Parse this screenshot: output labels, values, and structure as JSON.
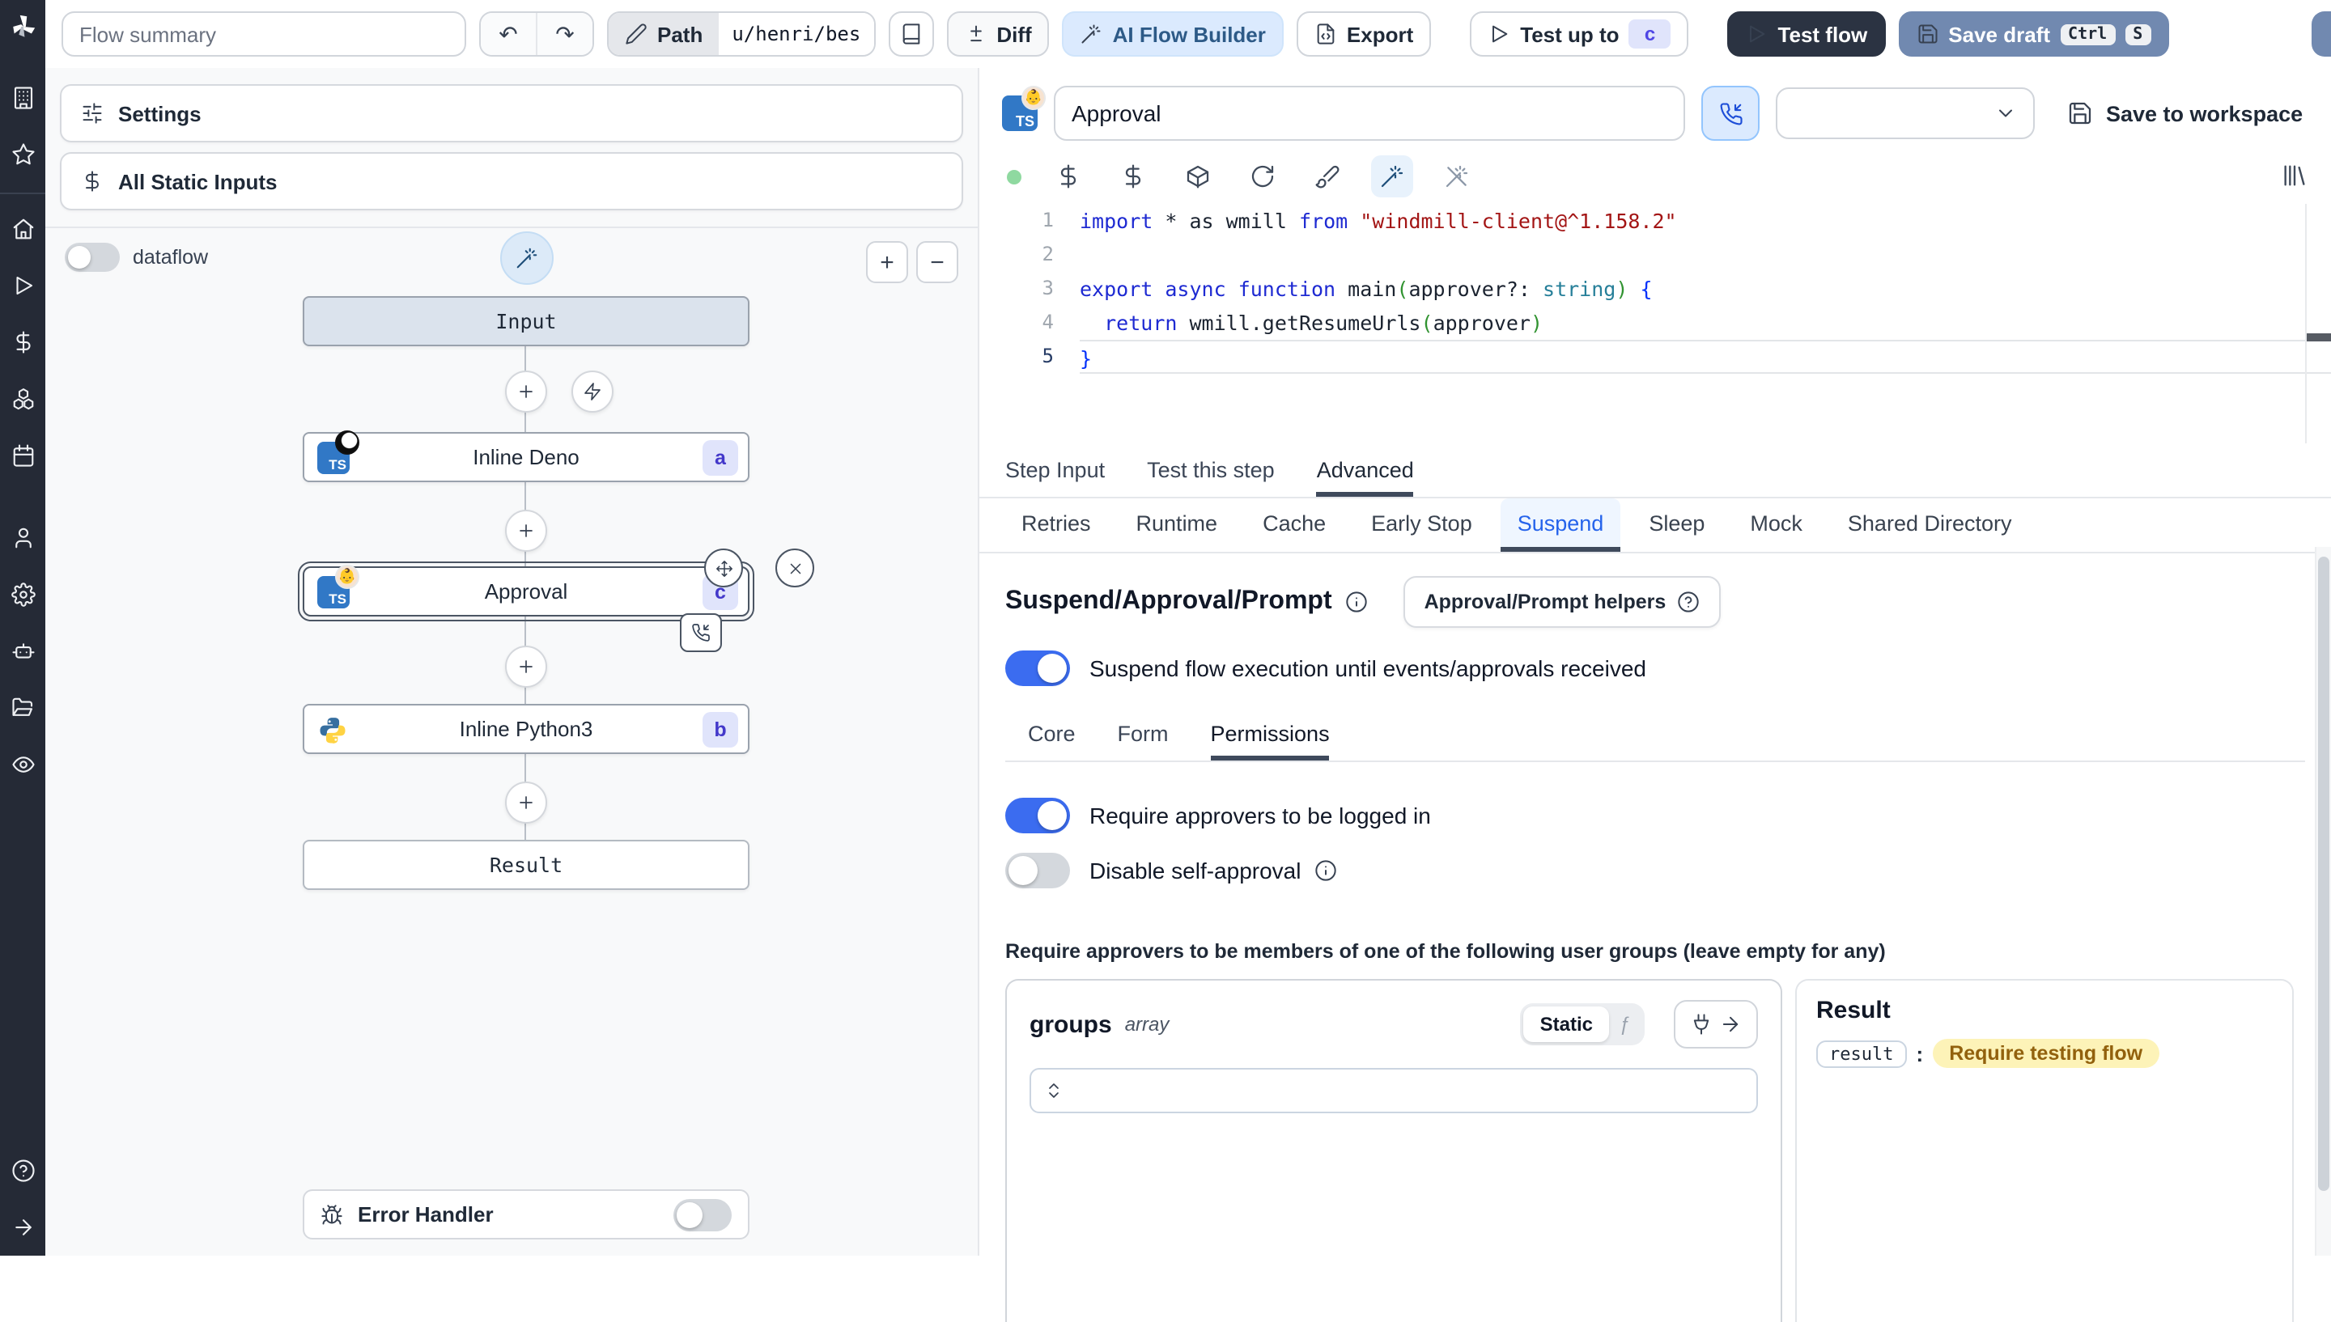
{
  "icons": {
    "undo": "↶",
    "redo": "↷",
    "zoom_in": "+",
    "zoom_out": "−",
    "fn": "ƒ",
    "baby": "👶"
  },
  "topbar": {
    "summary_placeholder": "Flow summary",
    "path_label": "Path",
    "path_value": "u/henri/bes",
    "diff": "Diff",
    "ai_flow_builder": "AI Flow Builder",
    "export": "Export",
    "test_up_to": "Test up to",
    "test_up_to_badge": "c",
    "test_flow": "Test flow",
    "save_draft": "Save draft",
    "key_ctrl": "Ctrl",
    "key_s": "S"
  },
  "left": {
    "settings": "Settings",
    "all_static_inputs": "All Static Inputs",
    "dataflow": "dataflow",
    "error_handler": "Error Handler",
    "graph": {
      "input": "Input",
      "deno_label": "Inline Deno",
      "deno_badge": "a",
      "approval_label": "Approval",
      "approval_badge": "c",
      "python_label": "Inline Python3",
      "python_badge": "b",
      "result": "Result"
    }
  },
  "editor": {
    "title": "Approval",
    "save_to_workspace": "Save to workspace",
    "code": {
      "lines": [
        [
          [
            "k",
            "import "
          ],
          [
            "d",
            "* as wmill "
          ],
          [
            "k",
            "from "
          ],
          [
            "s",
            "\"windmill-client@^1.158.2\""
          ]
        ],
        [],
        [
          [
            "k",
            "export "
          ],
          [
            "k",
            "async "
          ],
          [
            "k",
            "function "
          ],
          [
            "d",
            "main"
          ],
          [
            "pg",
            "("
          ],
          [
            "d",
            "approver?: "
          ],
          [
            "t",
            "string"
          ],
          [
            "pg",
            ") "
          ],
          [
            "pb",
            "{"
          ]
        ],
        [
          [
            "d",
            "  "
          ],
          [
            "k",
            "return "
          ],
          [
            "d",
            "wmill.getResumeUrls"
          ],
          [
            "pg",
            "("
          ],
          [
            "d",
            "approver"
          ],
          [
            "pg",
            ")"
          ]
        ],
        [
          [
            "pb",
            "}"
          ]
        ]
      ]
    }
  },
  "tabs": {
    "step": [
      "Step Input",
      "Test this step",
      "Advanced"
    ],
    "advanced": [
      "Retries",
      "Runtime",
      "Cache",
      "Early Stop",
      "Suspend",
      "Sleep",
      "Mock",
      "Shared Directory"
    ]
  },
  "suspend": {
    "heading": "Suspend/Approval/Prompt",
    "helpers_button": "Approval/Prompt helpers",
    "suspend_toggle": "Suspend flow execution until events/approvals received",
    "perm_tabs": [
      "Core",
      "Form",
      "Permissions"
    ],
    "require_login": "Require approvers to be logged in",
    "disable_self": "Disable self-approval",
    "groups_note": "Require approvers to be members of one of the following user groups (leave empty for any)"
  },
  "groups_panel": {
    "name": "groups",
    "type": "array",
    "static": "Static"
  },
  "result_panel": {
    "title": "Result",
    "key": "result",
    "colon": ":",
    "value": "Require testing flow"
  },
  "colors": {
    "accent_blue": "#3b6cf0",
    "badge_bg": "#e0e4fb",
    "badge_text": "#4338ca",
    "save_draft_bg": "#7189b0",
    "test_flow_bg": "#2b3342",
    "ai_builder_bg": "#dbeafe",
    "result_badge_bg": "#fdf3b8",
    "result_badge_text": "#92610d",
    "ts_badge_bg": "#3178c6"
  }
}
